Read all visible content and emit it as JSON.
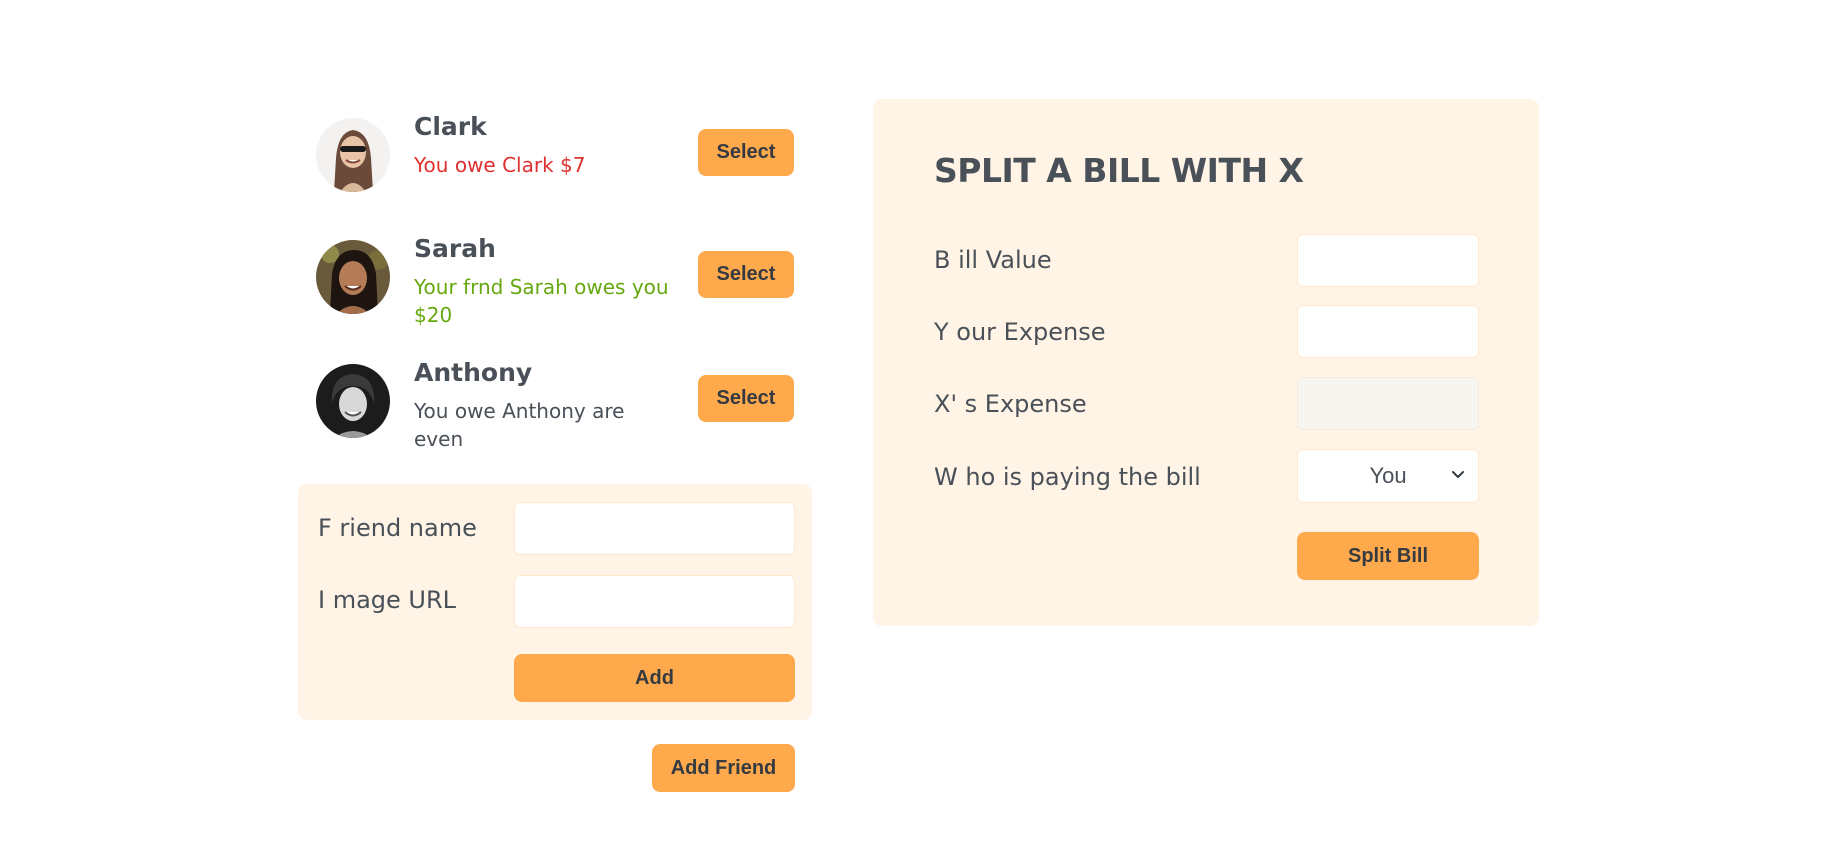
{
  "friends": [
    {
      "name": "Clark",
      "status": "You owe Clark $7",
      "status_kind": "negative",
      "button": "Select",
      "avatar": "person-photo"
    },
    {
      "name": "Sarah",
      "status": "Your frnd Sarah owes you $20",
      "status_kind": "positive",
      "button": "Select",
      "avatar": "person-photo"
    },
    {
      "name": "Anthony",
      "status": "You owe Anthony are even",
      "status_kind": "neutral",
      "button": "Select",
      "avatar": "person-photo"
    }
  ],
  "add_form": {
    "name_label": "F riend name",
    "name_value": "",
    "url_label": "I mage URL",
    "url_value": "",
    "add_button": "Add"
  },
  "add_friend_button": "Add Friend",
  "split_form": {
    "title": "SPLIT A BILL WITH X",
    "bill_label": "B ill Value",
    "bill_value": "",
    "your_expense_label": "Y our Expense",
    "your_expense_value": "",
    "x_expense_label": "X' s Expense",
    "x_expense_value": "",
    "payer_label": "W ho is paying the bill",
    "payer_selected": "You",
    "split_button": "Split Bill"
  },
  "colors": {
    "accent": "#ffa94d",
    "panel": "#fff4e6",
    "text": "#495057",
    "owe_red": "#e03131",
    "owed_green": "#66a80f"
  }
}
